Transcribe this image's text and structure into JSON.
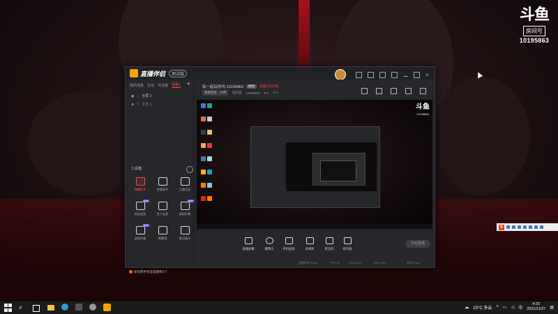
{
  "watermark": {
    "logo": "斗鱼",
    "label": "房间号",
    "room_id": "10195863"
  },
  "app": {
    "name": "直播伴侣",
    "version_badge": "测试版",
    "left_tabs": [
      "我的场景",
      "互动",
      "可信度",
      "场景1"
    ],
    "scene_main": "全屏 1",
    "scene_sub": "文本 1",
    "tools_title": "工具箱",
    "tools": [
      {
        "label": "弹幕助手",
        "icon": "danmaku-icon",
        "highlight": true,
        "badge": ""
      },
      {
        "label": "房管助手",
        "icon": "user-icon",
        "highlight": false,
        "badge": ""
      },
      {
        "label": "主播任务",
        "icon": "task-icon",
        "highlight": false,
        "badge": ""
      },
      {
        "label": "抢宝送奖",
        "icon": "gift-icon",
        "highlight": false,
        "badge": "NEW"
      },
      {
        "label": "多人连麦",
        "icon": "mic-link-icon",
        "highlight": false,
        "badge": ""
      },
      {
        "label": "虚拟形象",
        "icon": "avatar-icon",
        "highlight": false,
        "badge": "NEW"
      },
      {
        "label": "虚拟形象",
        "icon": "virtual-icon",
        "highlight": false,
        "badge": "NEW"
      },
      {
        "label": "弹幕墙",
        "icon": "wall-icon",
        "highlight": false,
        "badge": ""
      },
      {
        "label": "歌词展示",
        "icon": "lyrics-icon",
        "highlight": false,
        "badge": ""
      }
    ],
    "footer_tip": "如何把手机变成摄像头？",
    "room_title": "有一起玩的吗 10195863",
    "room_edit": "修改",
    "room_warning": "直播间未开播",
    "category": "绝地求生 · 大神",
    "streamer": "国庆猫",
    "room_number": "10195863",
    "likes": "0",
    "comments": "0",
    "controls": [
      {
        "label": "直播屏幕",
        "icon": "screen-icon"
      },
      {
        "label": "摄像头",
        "icon": "camera-icon"
      },
      {
        "label": "手机投屏",
        "icon": "phone-cast-icon"
      },
      {
        "label": "多媒体",
        "icon": "media-icon"
      },
      {
        "label": "麦克风",
        "icon": "microphone-icon"
      },
      {
        "label": "扬声器",
        "icon": "speaker-icon"
      }
    ],
    "start_button": "开始直播",
    "status": [
      "直播码率 0kbps",
      "FPS 30",
      "CPU 26%",
      "内存 45%",
      "帧率 30fps"
    ]
  },
  "taskbar": {
    "weather": "10°C 多云",
    "time": "4:23",
    "date": "2021/11/27",
    "language": "中"
  },
  "colors": {
    "accent": "#ff4a4a",
    "brand_orange": "#f5a400"
  }
}
